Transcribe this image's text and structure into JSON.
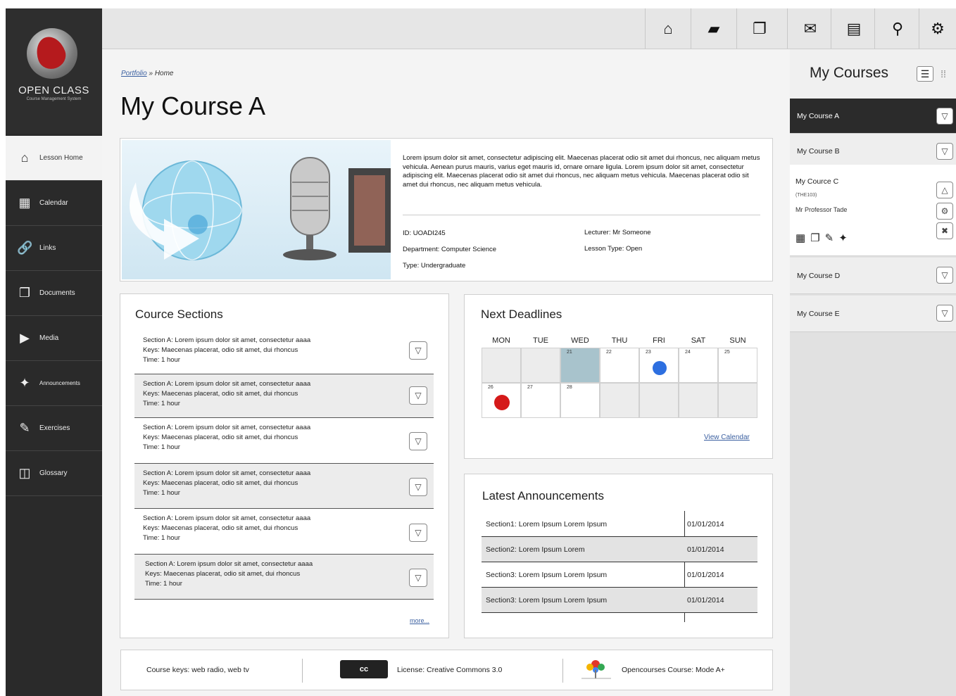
{
  "sidebar": {
    "logo_text": "OPEN CLASS",
    "logo_sub": "Course Management System",
    "items": [
      {
        "label": "Lesson Home",
        "icon": "home-icon"
      },
      {
        "label": "Calendar",
        "icon": "calendar-icon"
      },
      {
        "label": "Links",
        "icon": "link-icon"
      },
      {
        "label": "Documents",
        "icon": "documents-icon"
      },
      {
        "label": "Media",
        "icon": "play-icon"
      },
      {
        "label": "Announcements",
        "icon": "announcement-icon"
      },
      {
        "label": "Exercises",
        "icon": "edit-icon"
      },
      {
        "label": "Glossary",
        "icon": "book-icon"
      }
    ]
  },
  "topbar": {
    "icons": [
      "home-icon",
      "folder-icon",
      "documents-icon",
      "mail-icon",
      "list-icon",
      "search-icon",
      "gear-icon"
    ]
  },
  "breadcrumb": {
    "link": "Portfolio",
    "sep": " » ",
    "current": "Home"
  },
  "page_title": "My Course A",
  "banner": {
    "description": "Lorem ipsum dolor sit amet, consectetur adipiscing elit. Maecenas placerat odio sit amet dui rhoncus, nec aliquam metus vehicula. Aenean purus mauris, varius eget mauris id, ornare ornare ligula. Lorem ipsum dolor sit amet, consectetur adipiscing elit. Maecenas placerat odio sit amet dui rhoncus, nec aliquam metus vehicula. Maecenas placerat odio sit amet dui rhoncus, nec aliquam metus vehicula.",
    "id": "ID: UOADI245",
    "department": "Department: Computer Science",
    "type": "Type: Undergraduate",
    "lecturer": "Lecturer: Mr Someone",
    "lesson_type": "Lesson Type: Open"
  },
  "sections": {
    "title": "Cource Sections",
    "rows": [
      {
        "l1": "Section A: Lorem ipsum dolor sit amet, consectetur aaaa",
        "l2": "Keys: Maecenas placerat, odio sit amet, dui rhoncus",
        "l3": "Time: 1 hour"
      },
      {
        "l1": "Section A: Lorem ipsum dolor sit amet, consectetur aaaa",
        "l2": "Keys: Maecenas placerat, odio sit amet, dui rhoncus",
        "l3": "Time: 1 hour"
      },
      {
        "l1": "Section A: Lorem ipsum dolor sit amet, consectetur aaaa",
        "l2": "Keys: Maecenas placerat, odio sit amet, dui rhoncus",
        "l3": "Time: 1 hour"
      },
      {
        "l1": "Section A: Lorem ipsum dolor sit amet, consectetur aaaa",
        "l2": "Keys: Maecenas placerat, odio sit amet, dui rhoncus",
        "l3": "Time: 1 hour"
      },
      {
        "l1": "Section A: Lorem ipsum dolor sit amet, consectetur aaaa",
        "l2": "Keys: Maecenas placerat, odio sit amet, dui rhoncus",
        "l3": "Time: 1 hour"
      },
      {
        "l1": "Section A: Lorem ipsum dolor sit amet, consectetur aaaa",
        "l2": "Keys: Maecenas placerat, odio sit amet, dui rhoncus",
        "l3": "Time: 1 hour"
      }
    ],
    "more": "more..."
  },
  "deadlines": {
    "title": "Next Deadlines",
    "days": [
      "MON",
      "TUE",
      "WED",
      "THU",
      "FRI",
      "SAT",
      "SUN"
    ],
    "week1": [
      "",
      "",
      "21",
      "22",
      "23",
      "24",
      "25"
    ],
    "week2": [
      "26",
      "27",
      "28",
      "",
      "",
      "",
      ""
    ],
    "view_calendar": "View Calendar",
    "highlight_color": "#a8c3cc",
    "dot_blue": "#2d6fe0",
    "dot_red": "#d51a1a"
  },
  "announcements": {
    "title": "Latest Announcements",
    "rows": [
      {
        "text": "Section1: Lorem Ipsum Lorem Ipsum",
        "date": "01/01/2014"
      },
      {
        "text": "Section2: Lorem Ipsum Lorem",
        "date": "01/01/2014"
      },
      {
        "text": "Section3: Lorem Ipsum Lorem Ipsum",
        "date": "01/01/2014"
      },
      {
        "text": "Section3: Lorem Ipsum Lorem Ipsum",
        "date": "01/01/2014"
      }
    ]
  },
  "footer": {
    "keys": "Course keys: web radio, web tv",
    "license": "License: Creative Commons 3.0",
    "cc_badge": "cc",
    "opencourses": "Opencourses Course: Mode A+"
  },
  "right_panel": {
    "title": "My Courses",
    "courses": [
      {
        "name": "My Course A"
      },
      {
        "name": "My Course B"
      },
      {
        "name": "My Cource C",
        "code": "(THE103)",
        "professor": "Mr Professor Tade"
      },
      {
        "name": "My Course D"
      },
      {
        "name": "My Course E"
      }
    ]
  }
}
